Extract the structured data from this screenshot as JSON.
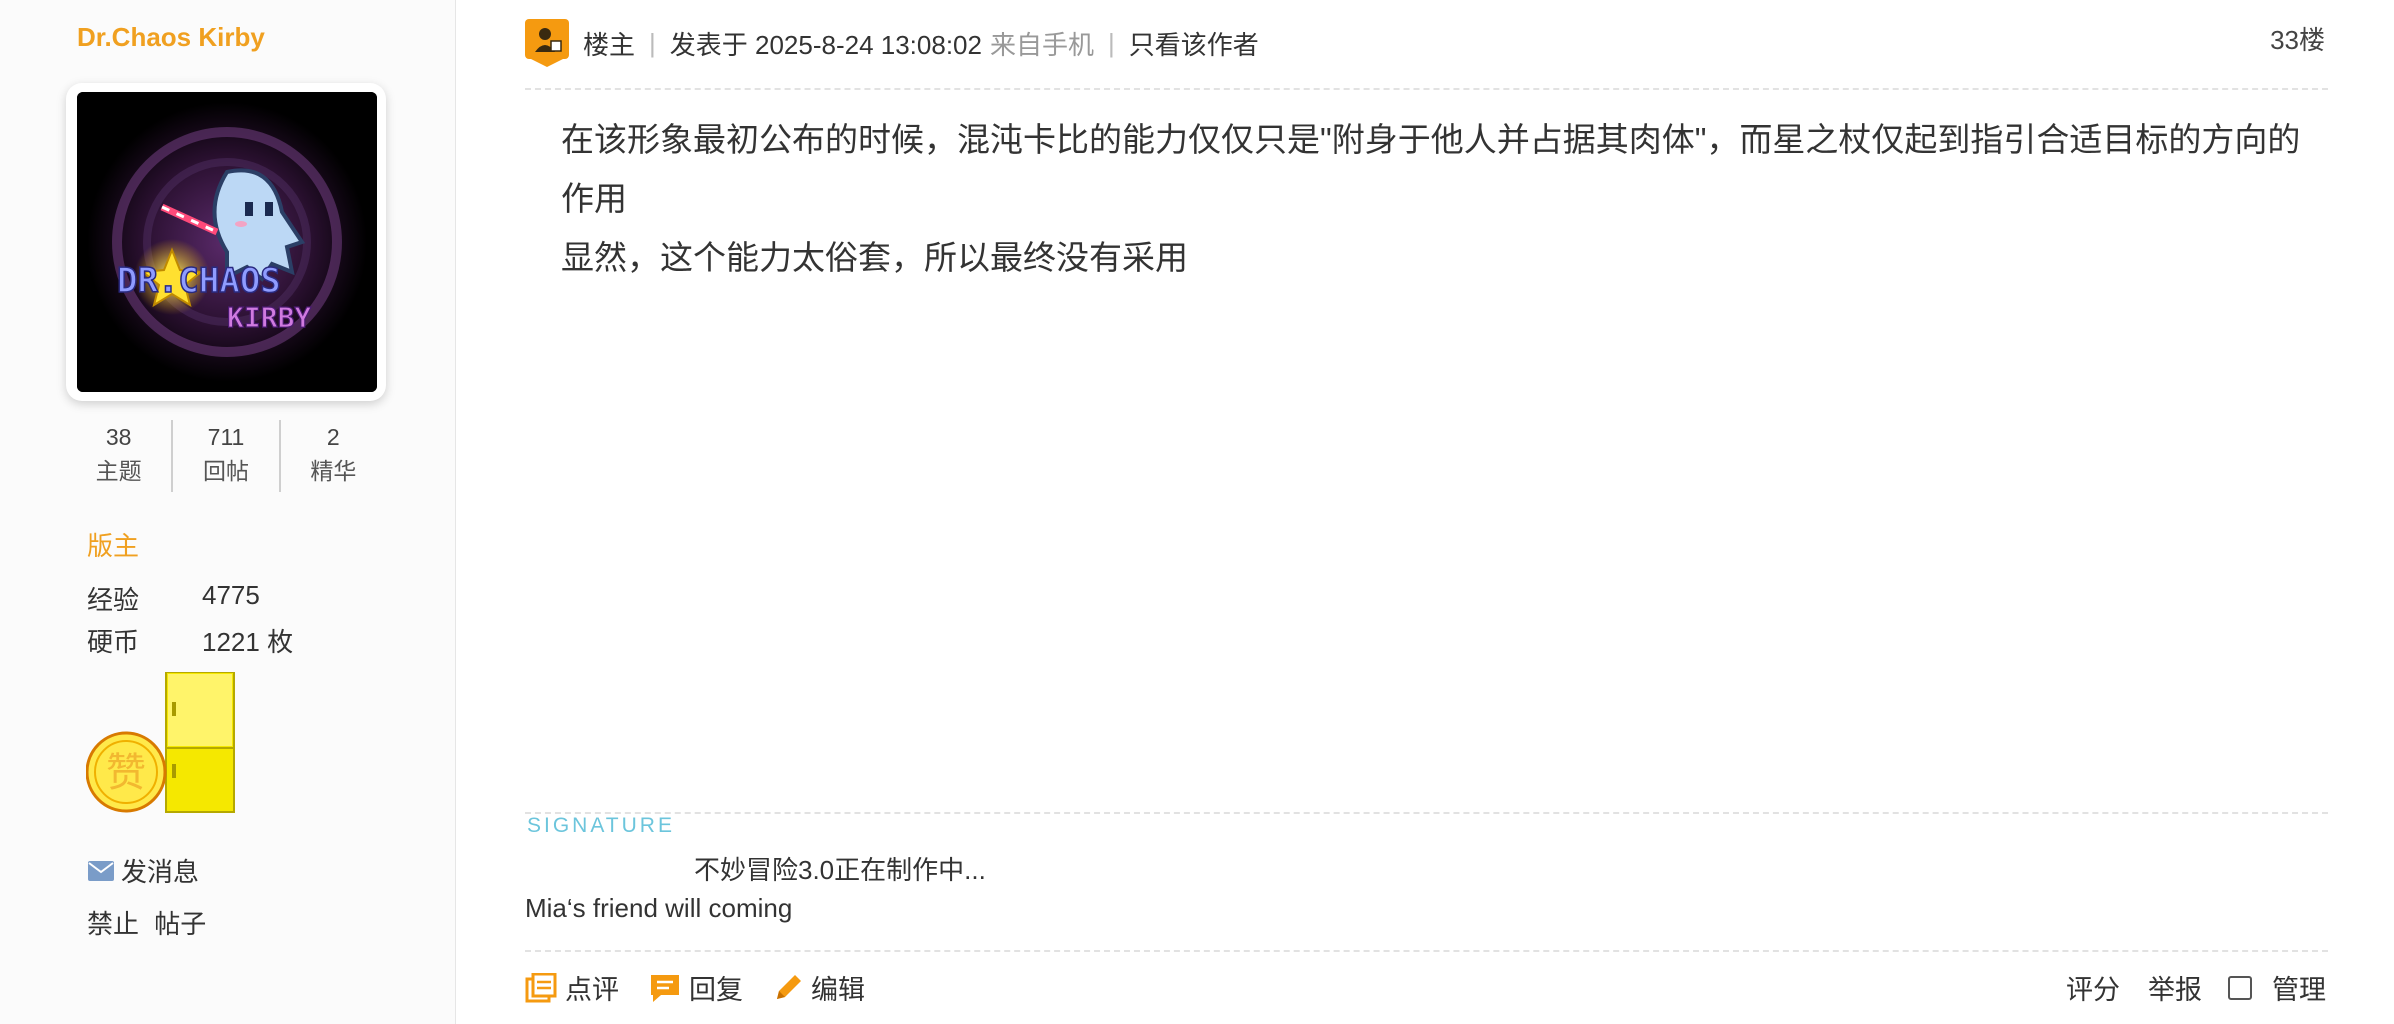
{
  "user": {
    "name": "Dr.Chaos Kirby",
    "avatar_text_1": "DR.CHAOS",
    "avatar_text_2": "KIRBY",
    "stats": [
      {
        "num": "38",
        "label": "主题"
      },
      {
        "num": "711",
        "label": "回帖"
      },
      {
        "num": "2",
        "label": "精华"
      }
    ],
    "rank": "版主",
    "exp_label": "经验",
    "exp_value": "4775",
    "coin_label": "硬币",
    "coin_value": "1221 枚",
    "medal_text": "赞",
    "send_message": "发消息",
    "ban_label": "禁止",
    "ban_post": "帖子"
  },
  "post": {
    "author_badge": "楼主",
    "posted_at": "发表于 2025-8-24 13:08:02",
    "from": "来自手机",
    "only_author": "只看该作者",
    "floor": "33楼",
    "content_line1": "在该形象最初公布的时候，混沌卡比的能力仅仅只是\"附身于他人并占据其肉体\"，而星之杖仅起到指引合适目标的方向的作用",
    "content_line2": "显然，这个能力太俗套，所以最终没有采用"
  },
  "signature": {
    "label": "SIGNATURE",
    "line1": "不妙冒险3.0正在制作中...",
    "line2": "Mia‘s friend will coming"
  },
  "actions": {
    "comment": "点评",
    "reply": "回复",
    "edit": "编辑",
    "rate": "评分",
    "report": "举报",
    "manage": "管理"
  },
  "colors": {
    "accent": "#f0a020",
    "signature": "#6cc5dc",
    "icon_orange": "#f59a10"
  }
}
